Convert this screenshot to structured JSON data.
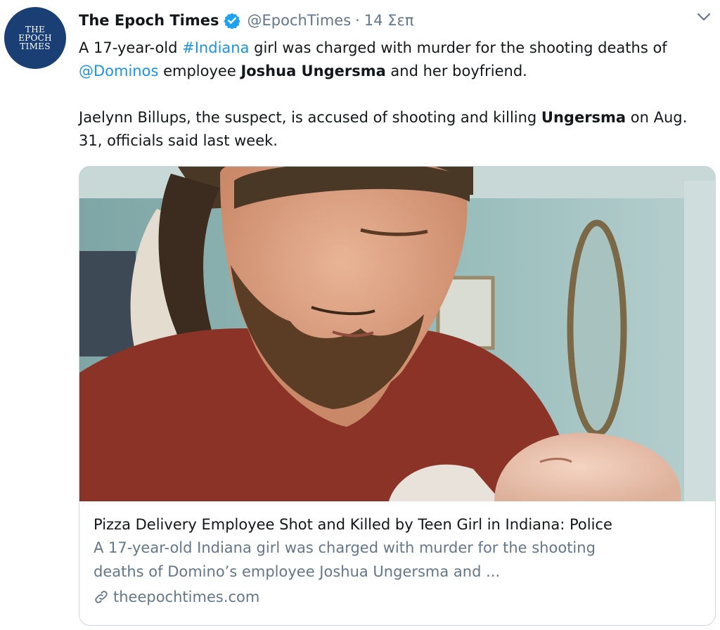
{
  "account": {
    "avatar_lines": [
      "THE",
      "EPOCH",
      "TIMES"
    ],
    "display_name": "The Epoch Times",
    "handle": "@EpochTimes",
    "separator": "·",
    "date": "14 Σεπ"
  },
  "tweet": {
    "p1": {
      "t1": "A 17-year-old ",
      "hashtag": "#Indiana",
      "t2": " girl was charged with murder for the shooting deaths of ",
      "mention": "@Dominos",
      "t3": " employee ",
      "bold_name": "Joshua Ungersma",
      "t4": " and her boyfriend."
    },
    "p2": {
      "t1": "Jaelynn Billups, the suspect, is accused of shooting and killing ",
      "bold_name": "Ungersma",
      "t2": " on Aug. 31, officials said last week."
    }
  },
  "card": {
    "title": "Pizza Delivery Employee Shot and Killed by Teen Girl in Indiana: Police",
    "description_lines": [
      "A 17-year-old Indiana girl was charged with murder for the shooting",
      "deaths of Domino’s employee Joshua Ungersma and ..."
    ],
    "domain": "theepochtimes.com"
  },
  "icons": {
    "verified": "verified-badge-icon",
    "caret": "chevron-down-icon",
    "link": "link-icon"
  },
  "colors": {
    "link": "#1b95e0",
    "muted": "#657786",
    "avatar_bg": "#1a3f75",
    "shirt": "#8a3326",
    "wall": "#8fb3b0"
  }
}
